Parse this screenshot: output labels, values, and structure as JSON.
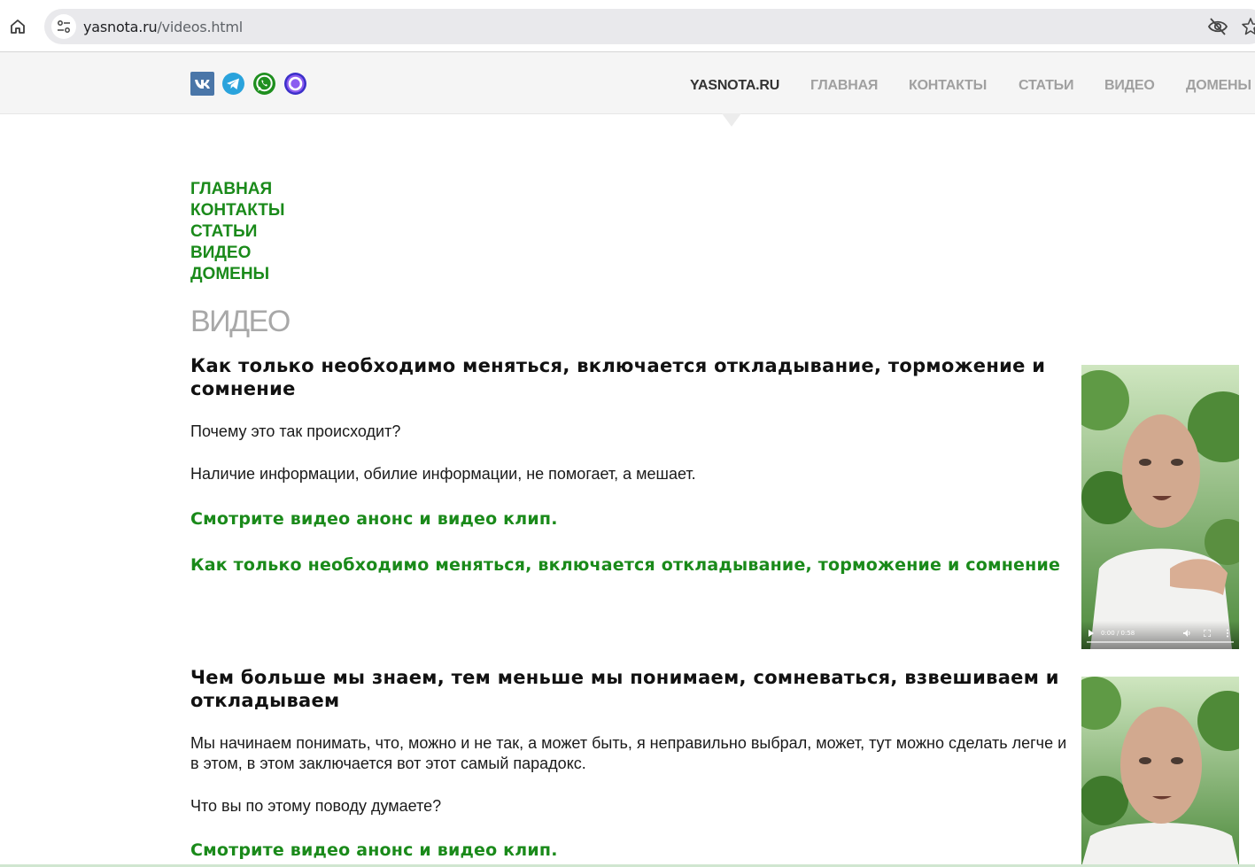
{
  "browser": {
    "url_host": "yasnota.ru",
    "url_path": "/videos.html"
  },
  "header": {
    "social_icons": [
      "vk-icon",
      "telegram-icon",
      "whatsapp-icon",
      "max-messenger-icon"
    ],
    "brand": "YASNOTA.RU",
    "nav": [
      "ГЛАВНАЯ",
      "КОНТАКТЫ",
      "СТАТЬИ",
      "ВИДЕО",
      "ДОМЕНЫ"
    ]
  },
  "sidenav": [
    "ГЛАВНАЯ",
    "КОНТАКТЫ",
    "СТАТЬИ",
    "ВИДЕО",
    "ДОМЕНЫ"
  ],
  "page_title": "ВИДЕО",
  "articles": [
    {
      "title": "Как только необходимо меняться, включается откладывание, торможение и сомнение",
      "paragraphs": [
        "Почему это так происходит?",
        "Наличие информации, обилие информации, не помогает, а мешает."
      ],
      "link_announce": "Смотрите видео анонс и видео клип.",
      "link_title": "Как только необходимо меняться, включается откладывание, торможение и сомнение",
      "video_time": "0:00 / 0:58"
    },
    {
      "title": "Чем больше мы знаем, тем меньше мы понимаем, сомневаться, взвешиваем и откладываем",
      "paragraphs": [
        "Мы начинаем понимать, что, можно и не так, а может быть, я неправильно выбрал, может, тут можно сделать легче и в этом, в этом заключается вот этот самый парадокс.",
        "Что вы по этому поводу думаете?"
      ],
      "link_announce": "Смотрите видео анонс и видео клип."
    }
  ],
  "colors": {
    "accent_green": "#1a8a1a",
    "nav_grey": "#a0a0a0",
    "header_bg": "#f5f5f5"
  }
}
